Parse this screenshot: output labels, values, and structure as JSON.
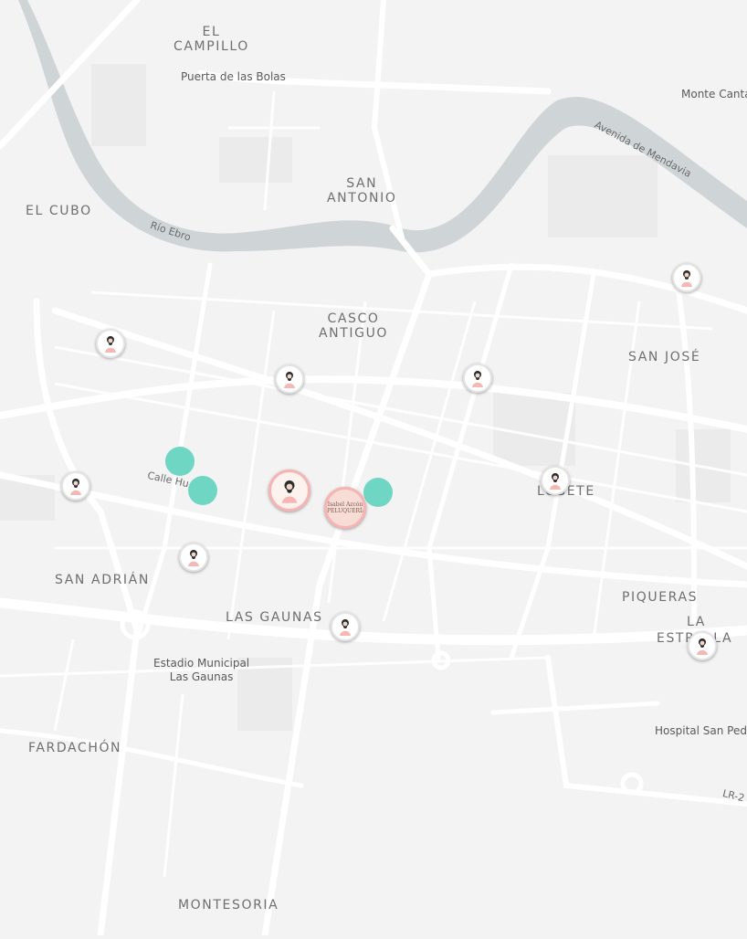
{
  "map": {
    "colors": {
      "land": "#f3f3f3",
      "road": "#ffffff",
      "minor_road": "#ffffff",
      "river": "#c9d0d2",
      "river_edge": "#bcc4c6",
      "block": "#e9e9e9",
      "cluster": "#6fd6c4",
      "pin_border": "#f6b4b4"
    },
    "labels": {
      "el_campillo": "EL\nCAMPILLO",
      "puerta_bolas": "Puerta de las Bolas",
      "monte_cantal": "Monte Cantal",
      "avenida_mendavia": "Avenida de Mendavia",
      "san_antonio": "SAN\nANTONIO",
      "el_cubo": "EL CUBO",
      "rio_ebro": "Río Ebro",
      "casco_antiguo": "CASCO\nANTIGUO",
      "san_jose": "SAN JOSÉ",
      "calle_hu": "Calle Hu",
      "lobete": "LOBETE",
      "san_adrian": "SAN ADRIÁN",
      "piqueras": "PIQUERAS",
      "las_gaunas": "LAS GAUNAS",
      "la_estrella_1": "LA",
      "la_estrella_2": "ESTRELLA",
      "estadio": "Estadio Municipal\nLas Gaunas",
      "hospital": "Hospital San Pedro",
      "fardachon": "FARDACHÓN",
      "lr2": "LR-2",
      "montesoria": "MONTESORIA"
    },
    "markers": {
      "logo_text": "Isabel Azcón\nPELUQUERÍA"
    }
  }
}
